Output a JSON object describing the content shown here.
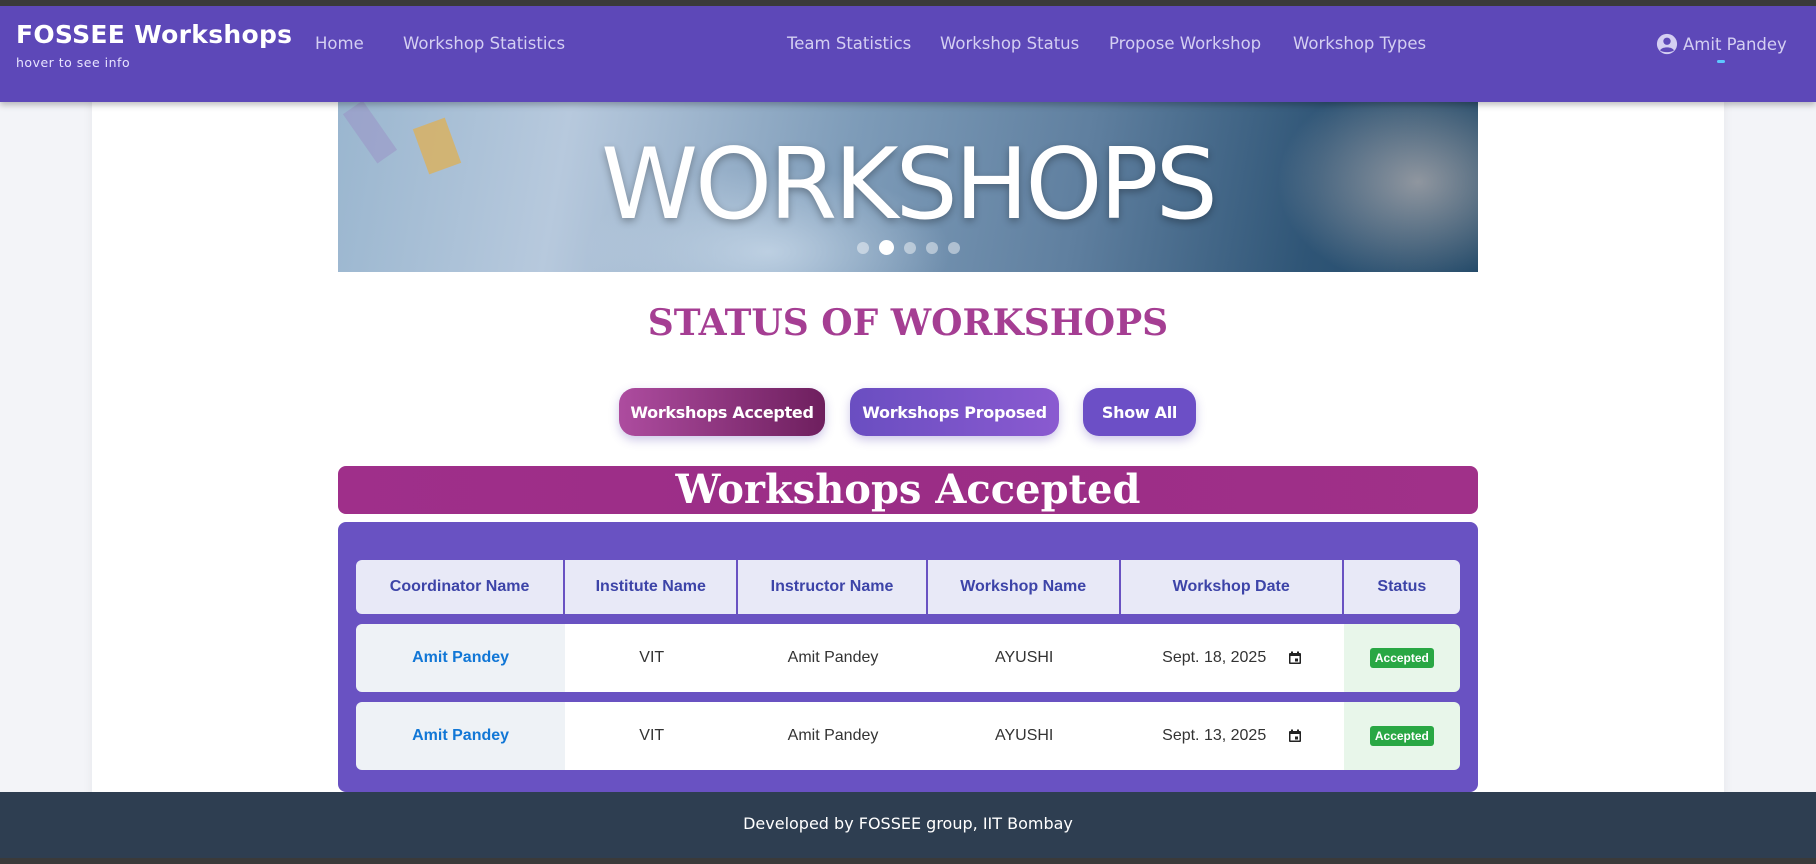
{
  "navbar": {
    "brand_title": "FOSSEE Workshops",
    "brand_subtitle": "hover to see info",
    "links": [
      "Home",
      "Workshop Statistics",
      "Team Statistics",
      "Workshop Status",
      "Propose Workshop",
      "Workshop Types"
    ],
    "user_name": "Amit Pandey",
    "user_icon": "user-circle-icon"
  },
  "hero": {
    "title": "WORKSHOPS",
    "slide_count": 5,
    "active_slide": 2
  },
  "status_heading": "STATUS OF WORKSHOPS",
  "filters": {
    "accepted": "Workshops Accepted",
    "proposed": "Workshops Proposed",
    "all": "Show All"
  },
  "section_title": "Workshops Accepted",
  "table": {
    "headers": [
      "Coordinator Name",
      "Institute Name",
      "Instructor Name",
      "Workshop Name",
      "Workshop Date",
      "Status"
    ],
    "rows": [
      {
        "coordinator": "Amit Pandey",
        "institute": "VIT",
        "instructor": "Amit Pandey",
        "workshop": "AYUSHI",
        "date": "Sept. 18, 2025",
        "status": "Accepted"
      },
      {
        "coordinator": "Amit Pandey",
        "institute": "VIT",
        "instructor": "Amit Pandey",
        "workshop": "AYUSHI",
        "date": "Sept. 13, 2025",
        "status": "Accepted"
      }
    ]
  },
  "footer": "Developed by FOSSEE group, IIT Bombay",
  "colors": {
    "navbar": "#5d48b8",
    "heading": "#a53e93",
    "banner": "#9f2f8a",
    "table_bg": "#6952c2",
    "badge": "#29a744",
    "footer": "#2e3e51"
  }
}
